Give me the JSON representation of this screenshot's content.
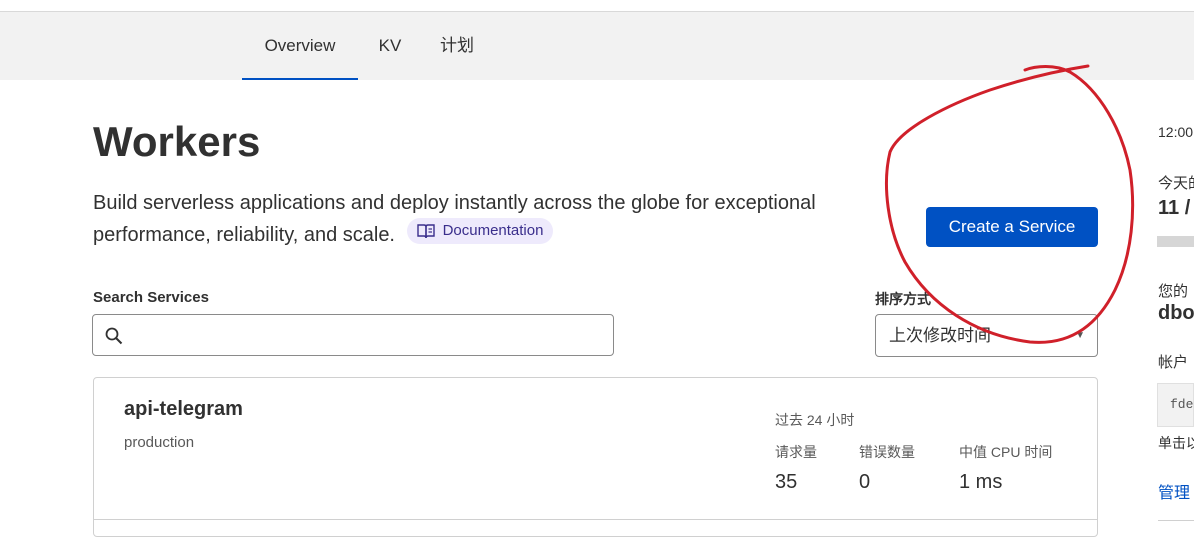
{
  "tabs": [
    {
      "label": "Overview",
      "active": true
    },
    {
      "label": "KV",
      "active": false
    },
    {
      "label": "计划",
      "active": false
    }
  ],
  "page": {
    "title": "Workers",
    "description": "Build serverless applications and deploy instantly across the globe for exceptional performance, reliability, and scale.",
    "doc_link": "Documentation",
    "create_button": "Create a Service"
  },
  "search": {
    "label": "Search Services",
    "value": "",
    "placeholder": ""
  },
  "sort": {
    "label": "排序方式",
    "selected": "上次修改时间"
  },
  "services": [
    {
      "name": "api-telegram",
      "environment": "production",
      "period": "过去 24 小时",
      "metrics": [
        {
          "label": "请求量",
          "value": "35"
        },
        {
          "label": "错误数量",
          "value": "0"
        },
        {
          "label": "中值 CPU 时间",
          "value": "1 ms"
        }
      ]
    }
  ],
  "right_panel": {
    "time": "12:00",
    "today_label": "今天的",
    "today_value": "11 /",
    "account_label": "您的",
    "account_value": "dbo",
    "id_label": "帐户",
    "id_value": "fde",
    "click_hint": "单击以",
    "manage_link": "管理"
  },
  "colors": {
    "accent": "#0051c3",
    "annotation": "#d0202a"
  }
}
